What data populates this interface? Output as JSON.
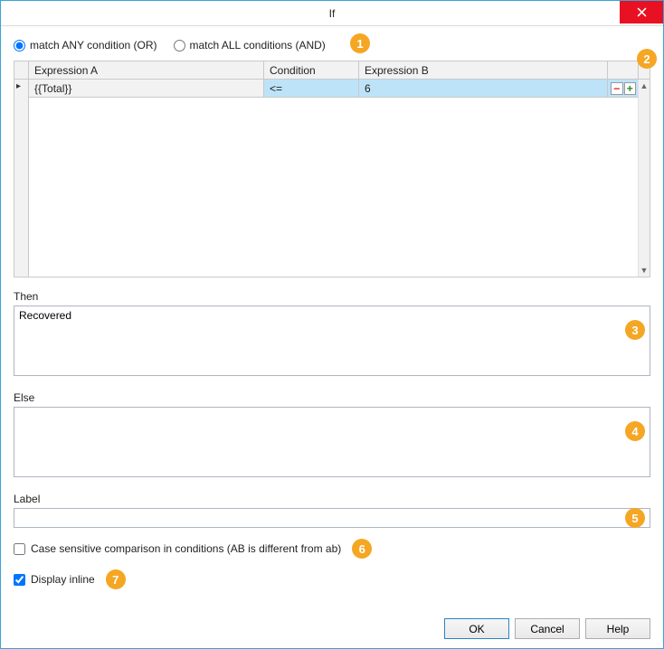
{
  "window": {
    "title": "If"
  },
  "match": {
    "any_label": "match ANY condition (OR)",
    "all_label": "match ALL conditions (AND)",
    "selected": "any"
  },
  "grid": {
    "columns": {
      "expr_a": "Expression A",
      "condition": "Condition",
      "expr_b": "Expression B"
    },
    "rows": [
      {
        "expr_a": "{{Total}}",
        "condition": "<=",
        "expr_b": "6"
      }
    ]
  },
  "then": {
    "label": "Then",
    "value": "Recovered"
  },
  "else": {
    "label": "Else",
    "value": ""
  },
  "label_field": {
    "label": "Label",
    "value": ""
  },
  "checks": {
    "case_sensitive_label": "Case sensitive comparison in conditions (AB is different from ab)",
    "case_sensitive_checked": false,
    "display_inline_label": "Display inline",
    "display_inline_checked": true
  },
  "buttons": {
    "ok": "OK",
    "cancel": "Cancel",
    "help": "Help"
  },
  "callouts": [
    "1",
    "2",
    "3",
    "4",
    "5",
    "6",
    "7"
  ]
}
